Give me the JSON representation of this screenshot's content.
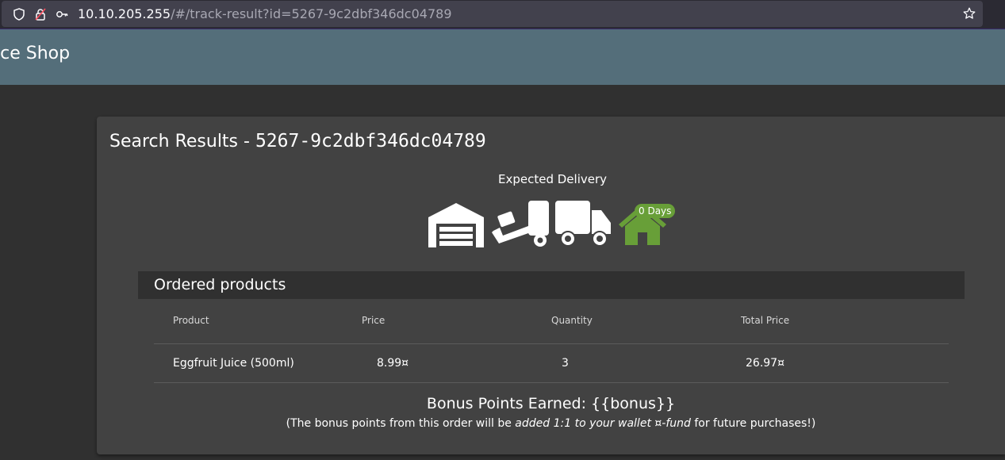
{
  "browser": {
    "url_host": "10.10.205.255",
    "url_path": "/#/track-result?id=5267-9c2dbf346dc04789",
    "icons": [
      "shield-icon",
      "lock-warning-icon",
      "key-icon",
      "star-bookmark-icon"
    ]
  },
  "app": {
    "title": "ice Shop",
    "toolbar_color": "#546e7a"
  },
  "result": {
    "title_prefix": "Search Results - ",
    "order_id": "5267-9c2dbf346dc04789",
    "delivery_label": "Expected Delivery",
    "delivery_stages": [
      "warehouse-icon",
      "dolly-icon",
      "truck-icon",
      "home-icon"
    ],
    "days_badge": "0 Days",
    "accent_color": "#689f38"
  },
  "products": {
    "title": "Ordered products",
    "columns": [
      "Product",
      "Price",
      "Quantity",
      "Total Price"
    ],
    "rows": [
      {
        "product": "Eggfruit Juice (500ml)",
        "price": "8.99¤",
        "quantity": "3",
        "total": "26.97¤"
      }
    ]
  },
  "bonus": {
    "title": "Bonus Points Earned: {{bonus}}",
    "text_before": "(The bonus points from this order will be ",
    "text_emphasis": "added 1:1 to your wallet ¤-fund",
    "text_after": " for future purchases!)"
  }
}
